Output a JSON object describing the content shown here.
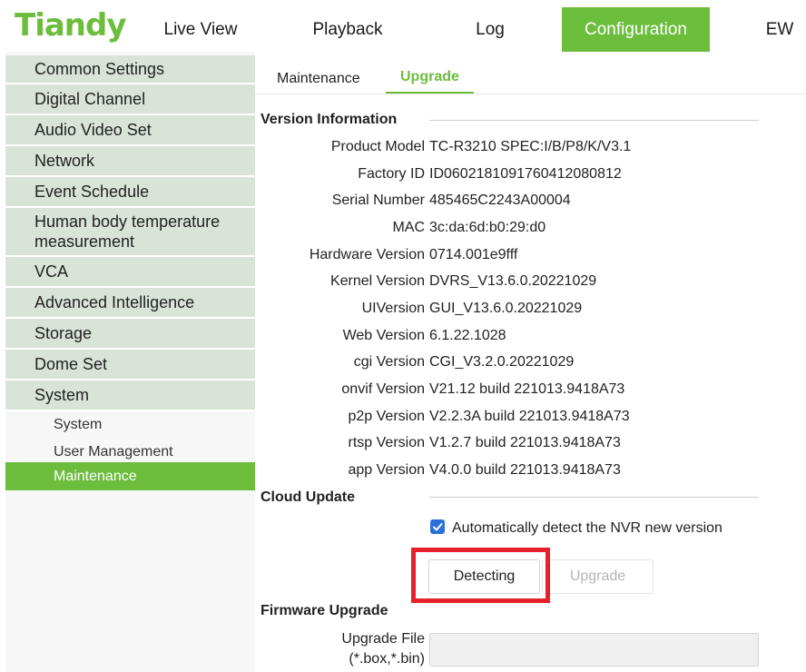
{
  "header": {
    "logo": "Tiandy",
    "nav": [
      {
        "label": "Live View"
      },
      {
        "label": "Playback"
      },
      {
        "label": "Log"
      },
      {
        "label": "Configuration"
      },
      {
        "label": "EW"
      }
    ],
    "accent_color": "#6cbd3c"
  },
  "sidebar": {
    "items": [
      {
        "label": "Common Settings"
      },
      {
        "label": "Digital Channel"
      },
      {
        "label": "Audio Video Set"
      },
      {
        "label": "Network"
      },
      {
        "label": "Event Schedule"
      },
      {
        "label": "Human body temperature measurement"
      },
      {
        "label": "VCA"
      },
      {
        "label": "Advanced Intelligence"
      },
      {
        "label": "Storage"
      },
      {
        "label": "Dome Set"
      },
      {
        "label": "System"
      }
    ],
    "subitems": [
      {
        "label": "System"
      },
      {
        "label": "User Management"
      },
      {
        "label": "Maintenance"
      }
    ]
  },
  "tabs": [
    {
      "label": "Maintenance"
    },
    {
      "label": "Upgrade"
    }
  ],
  "version_info": {
    "title": "Version Information",
    "rows": [
      {
        "label": "Product Model",
        "value": "TC-R3210 SPEC:I/B/P8/K/V3.1"
      },
      {
        "label": "Factory ID",
        "value": "ID0602181091760412080812"
      },
      {
        "label": "Serial Number",
        "value": "485465C2243A00004"
      },
      {
        "label": "MAC",
        "value": "3c:da:6d:b0:29:d0"
      },
      {
        "label": "Hardware Version",
        "value": "0714.001e9fff"
      },
      {
        "label": "Kernel Version",
        "value": "DVRS_V13.6.0.20221029"
      },
      {
        "label": "UIVersion",
        "value": "GUI_V13.6.0.20221029"
      },
      {
        "label": "Web Version",
        "value": "6.1.22.1028"
      },
      {
        "label": "cgi Version",
        "value": "CGI_V3.2.0.20221029"
      },
      {
        "label": "onvif Version",
        "value": "V21.12 build 221013.9418A73"
      },
      {
        "label": "p2p Version",
        "value": "V2.2.3A build 221013.9418A73"
      },
      {
        "label": "rtsp Version",
        "value": "V1.2.7 build 221013.9418A73"
      },
      {
        "label": "app Version",
        "value": "V4.0.0 build 221013.9418A73"
      }
    ]
  },
  "cloud_update": {
    "title": "Cloud Update",
    "auto_detect_label": "Automatically detect the NVR new version",
    "auto_detect_checked": true,
    "detecting_button": "Detecting",
    "upgrade_button": "Upgrade"
  },
  "firmware_upgrade": {
    "title": "Firmware Upgrade",
    "file_label_line1": "Upgrade File",
    "file_label_line2": "(*.box,*.bin)",
    "file_value": ""
  }
}
